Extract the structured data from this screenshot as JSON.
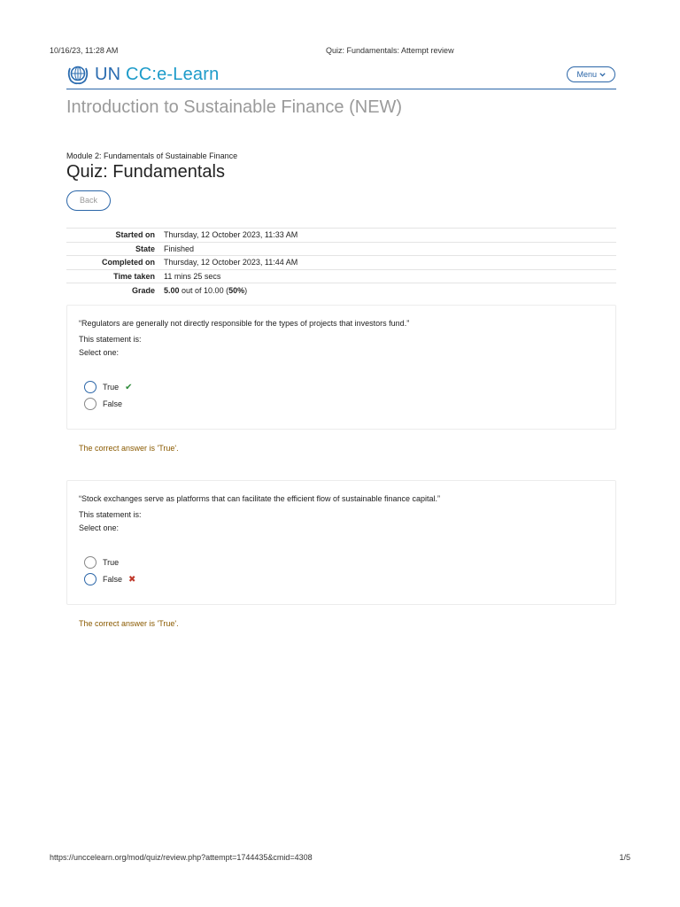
{
  "print_header": {
    "datetime": "10/16/23, 11:28 AM",
    "doc_title": "Quiz: Fundamentals: Attempt review"
  },
  "site": {
    "logo_prefix": "UN ",
    "logo_suffix": "CC:e-Learn",
    "logo_icon": "un-emblem-icon",
    "menu_label": "Menu",
    "brand_color": "#1d9bc9"
  },
  "course_title": "Introduction to Sustainable Finance (NEW)",
  "breadcrumb": "Module 2: Fundamentals of Sustainable Finance",
  "quiz_title": "Quiz: Fundamentals",
  "back_label": "Back",
  "summary": [
    {
      "label": "Started on",
      "value": "Thursday, 12 October 2023, 11:33 AM"
    },
    {
      "label": "State",
      "value": "Finished"
    },
    {
      "label": "Completed on",
      "value": "Thursday, 12 October 2023, 11:44 AM"
    },
    {
      "label": "Time taken",
      "value": "11 mins 25 secs"
    },
    {
      "label": "Grade",
      "value_bold": "5.00",
      "value_mid": " out of 10.00 (",
      "value_pct": "50%",
      "value_end": ")"
    }
  ],
  "questions": [
    {
      "text": "“Regulators are generally not directly responsible for the types of projects that investors fund.”",
      "prompt": "This statement is:",
      "instruction": "Select one:",
      "options": [
        {
          "label": "True",
          "selected": true,
          "mark": "correct"
        },
        {
          "label": "False",
          "selected": false,
          "mark": ""
        }
      ],
      "feedback": "The correct answer is 'True'."
    },
    {
      "text": "“Stock exchanges serve as platforms that can facilitate the efficient flow of sustainable finance capital.”",
      "prompt": "This statement is:",
      "instruction": "Select one:",
      "options": [
        {
          "label": "True",
          "selected": false,
          "mark": ""
        },
        {
          "label": "False",
          "selected": true,
          "mark": "incorrect"
        }
      ],
      "feedback": "The correct answer is 'True'."
    }
  ],
  "print_footer": {
    "url": "https://unccelearn.org/mod/quiz/review.php?attempt=1744435&cmid=4308",
    "page": "1/5"
  }
}
